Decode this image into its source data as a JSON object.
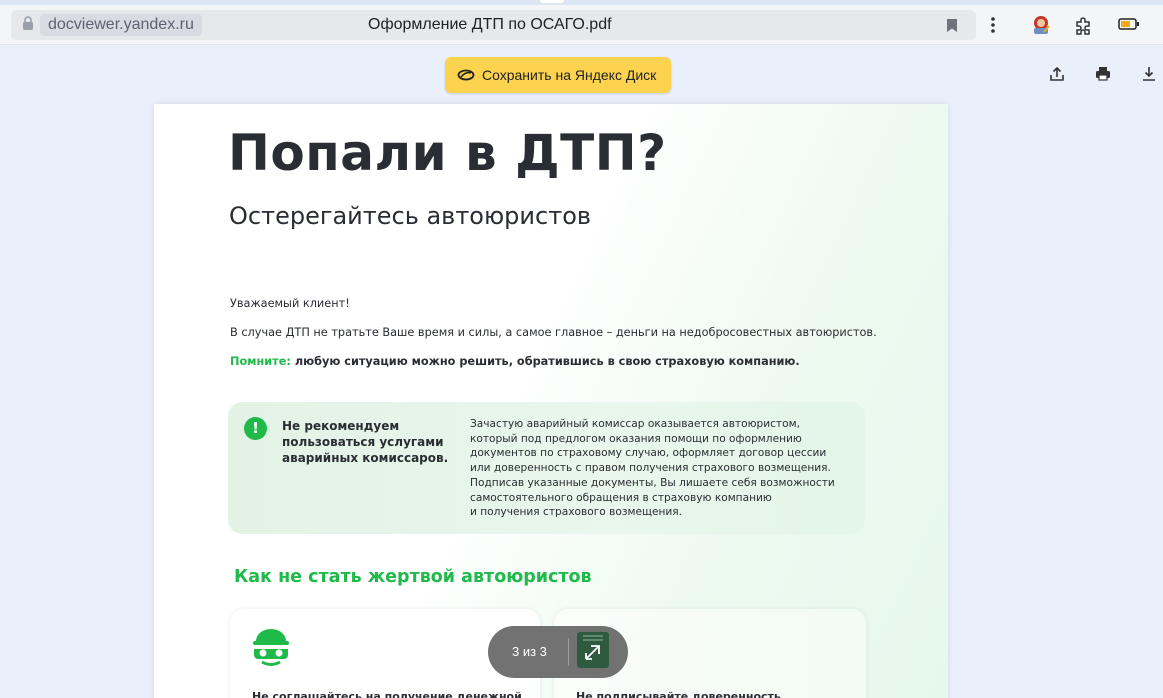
{
  "browser": {
    "domain": "docviewer.yandex.ru",
    "tab_title": "Оформление ДТП по ОСАГО.pdf",
    "icons": [
      "lock-icon",
      "bookmark-icon",
      "more-vert-icon",
      "extension-avatar-icon",
      "puzzle-icon",
      "battery-icon"
    ]
  },
  "toolbar": {
    "save_label": "Сохранить на Яндекс Диск",
    "icons": [
      "share-icon",
      "print-icon",
      "download-icon"
    ]
  },
  "document": {
    "title": "Попали в ДТП?",
    "subtitle": "Остерегайтесь автоюристов",
    "greeting": "Уважаемый клиент!",
    "paragraph1": "В случае ДТП не тратьте Ваше время и силы, а самое главное – деньги на недобросовестных автоюристов.",
    "remember_label": "Помните:",
    "remember_text": " любую ситуацию можно решить, обратившись в свою страховую компанию.",
    "warning": {
      "title": "Не рекомендуем пользоваться услугами аварийных комиссаров.",
      "lines": [
        "Зачастую аварийный комиссар оказывается автоюристом,",
        "который под предлогом оказания помощи по оформлению",
        "документов по страховому случаю, оформляет договор цессии",
        "или доверенность с правом получения страхового возмещения.",
        "Подписав указанные документы, Вы лишаете себя возможности",
        "самостоятельного обращения в страховую компанию",
        "и получения страхового возмещения."
      ]
    },
    "section_title": "Как не стать жертвой автоюристов",
    "cards": [
      {
        "title": "Не соглашайтесь на получение денежной"
      },
      {
        "title": "Не подписывайте доверенность"
      }
    ]
  },
  "pager": {
    "text": "3 из 3"
  },
  "colors": {
    "accent_green": "#1fba4a",
    "save_button": "#fcd34f",
    "viewer_bg": "#e9effb"
  }
}
